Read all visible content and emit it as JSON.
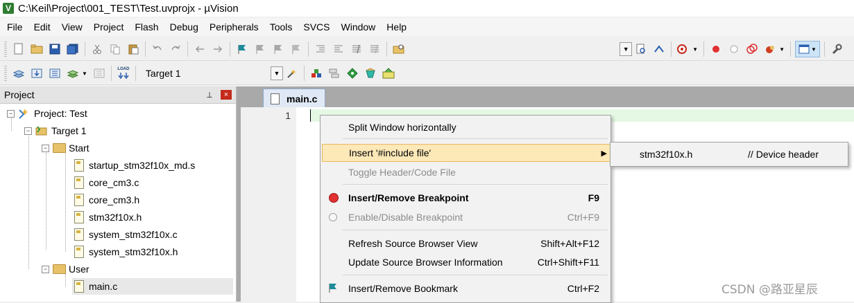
{
  "window": {
    "title": "C:\\Keil\\Project\\001_TEST\\Test.uvprojx - µVision",
    "icon_letter": "V"
  },
  "menubar": [
    "File",
    "Edit",
    "View",
    "Project",
    "Flash",
    "Debug",
    "Peripherals",
    "Tools",
    "SVCS",
    "Window",
    "Help"
  ],
  "toolbar2": {
    "load_label": "LOAD",
    "target": "Target 1"
  },
  "project_panel": {
    "title": "Project",
    "pin": "⊥",
    "close": "×",
    "tree": {
      "root": "Project: Test",
      "target": "Target 1",
      "group_start": "Start",
      "start_files": [
        "startup_stm32f10x_md.s",
        "core_cm3.c",
        "core_cm3.h",
        "stm32f10x.h",
        "system_stm32f10x.c",
        "system_stm32f10x.h"
      ],
      "group_user": "User",
      "user_files": [
        "main.c"
      ]
    },
    "expanded_symbol": "−"
  },
  "editor": {
    "tab_label": "main.c",
    "line_number": "1"
  },
  "context_menu": {
    "split": "Split Window horizontally",
    "insert_include": "Insert '#include file'",
    "toggle_header": "Toggle Header/Code File",
    "insert_bp": "Insert/Remove Breakpoint",
    "insert_bp_key": "F9",
    "enable_bp": "Enable/Disable Breakpoint",
    "enable_bp_key": "Ctrl+F9",
    "refresh_browser": "Refresh Source Browser View",
    "refresh_browser_key": "Shift+Alt+F12",
    "update_browser": "Update Source Browser Information",
    "update_browser_key": "Ctrl+Shift+F11",
    "bookmark": "Insert/Remove Bookmark",
    "bookmark_key": "Ctrl+F2",
    "submenu_arrow": "▶"
  },
  "submenu": {
    "file": "stm32f10x.h",
    "comment": "// Device header"
  },
  "watermark": "CSDN @路亚星辰",
  "colors": {
    "menu_highlight": "#fde8b8",
    "code_line": "#e4f8e4",
    "panel_close": "#c42b1c"
  },
  "icons": {
    "combo_arrow": "▼"
  }
}
